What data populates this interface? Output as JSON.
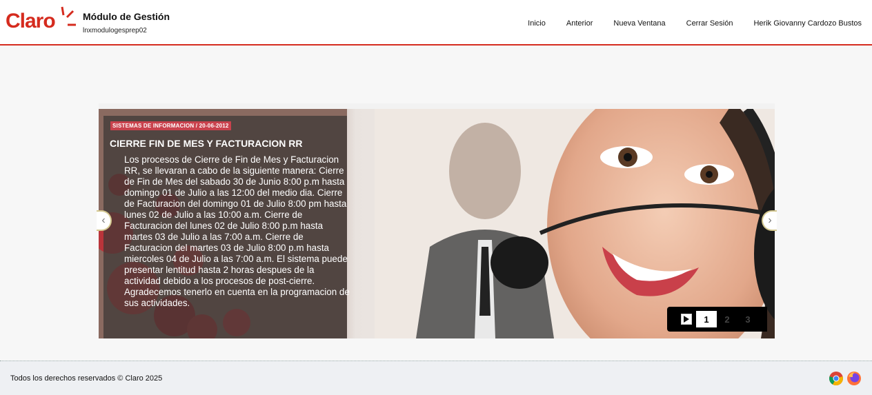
{
  "header": {
    "logo_text": "Claro",
    "app_title": "Módulo de Gestión",
    "app_subtitle": "lnxmodulogesprep02",
    "nav": [
      "Inicio",
      "Anterior",
      "Nueva Ventana",
      "Cerrar Sesión",
      "Herik Giovanny Cardozo Bustos"
    ]
  },
  "slider": {
    "tag": "SISTEMAS DE INFORMACION / 20-06-2012",
    "title": "CIERRE FIN DE MES Y FACTURACION RR",
    "body": "Los procesos de Cierre de Fin de Mes y Facturacion RR, se llevaran a cabo de la siguiente manera: Cierre de Fin de Mes del sabado 30 de Junio 8:00 p.m hasta domingo 01 de Julio a las 12:00 del medio dia. Cierre de Facturacion del domingo 01 de Julio 8:00 pm hasta lunes 02 de Julio a las 10:00 a.m. Cierre de Facturacion del lunes 02 de Julio 8:00 p.m hasta martes 03 de Julio a las 7:00 a.m. Cierre de Facturacion del martes 03 de Julio 8:00 p.m hasta miercoles 04 de Julio a las 7:00 a.m. El sistema puede presentar lentitud hasta 2 horas despues de la actividad debido a los procesos de post-cierre. Agradecemos tenerlo en cuenta en la programacion de sus actividades.",
    "prev_icon": "chevron-left-icon",
    "next_icon": "chevron-right-icon",
    "pages": [
      "1",
      "2",
      "3"
    ],
    "active_page": "1"
  },
  "footer": {
    "copyright": "Todos los derechos reservados © Claro 2025",
    "browser_icons": [
      "chrome-icon",
      "firefox-icon"
    ]
  },
  "colors": {
    "brand": "#d52b1e",
    "tag": "#c9424d"
  }
}
